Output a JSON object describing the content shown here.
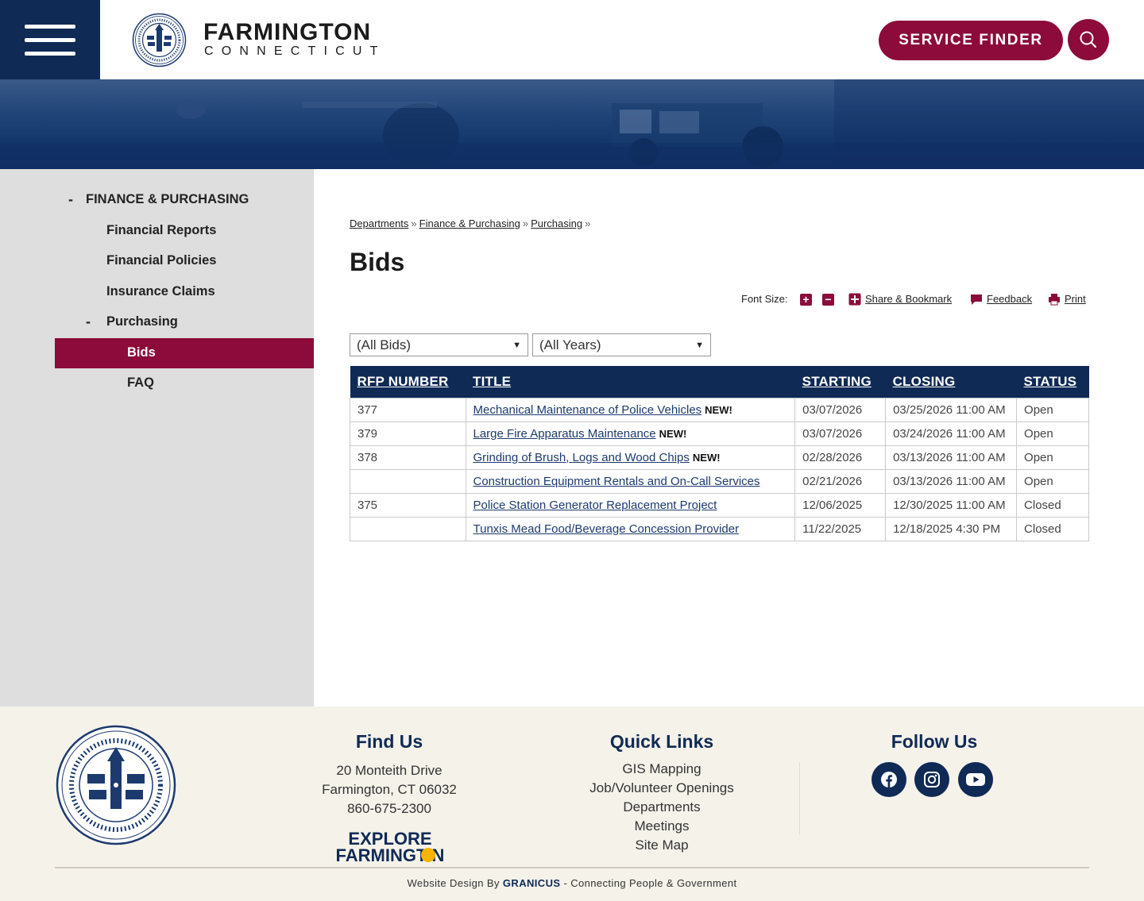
{
  "header": {
    "brand_name": "FARMINGTON",
    "brand_sub": "CONNECTICUT",
    "service_finder": "SERVICE FINDER"
  },
  "sidebar": {
    "section_title": "FINANCE & PURCHASING",
    "items": [
      "Financial Reports",
      "Financial Policies",
      "Insurance Claims",
      "Purchasing"
    ],
    "sub_items": [
      "Bids",
      "FAQ"
    ]
  },
  "breadcrumb": [
    "Departments",
    "Finance & Purchasing",
    "Purchasing"
  ],
  "page_title": "Bids",
  "tools": {
    "font_size_label": "Font Size:",
    "share": "Share & Bookmark",
    "feedback": "Feedback",
    "print": "Print"
  },
  "filters": {
    "bids": "(All Bids)",
    "years": "(All Years)"
  },
  "table": {
    "headers": [
      "RFP NUMBER",
      "TITLE",
      "STARTING",
      "CLOSING",
      "STATUS"
    ],
    "new_tag": "NEW!",
    "rows": [
      {
        "rfp": "377",
        "title": "Mechanical Maintenance of Police Vehicles",
        "new": "NEW!",
        "start": "03/07/2026",
        "close": "03/25/2026 11:00 AM",
        "status": "Open"
      },
      {
        "rfp": "379",
        "title": "Large Fire Apparatus Maintenance",
        "new": "NEW!",
        "start": "03/07/2026",
        "close": "03/24/2026 11:00 AM",
        "status": "Open"
      },
      {
        "rfp": "378",
        "title": "Grinding of Brush, Logs and Wood Chips",
        "new": "NEW!",
        "start": "02/28/2026",
        "close": "03/13/2026 11:00 AM",
        "status": "Open"
      },
      {
        "rfp": "",
        "title": "Construction Equipment Rentals and On-Call Services",
        "new": "",
        "start": "02/21/2026",
        "close": "03/13/2026 11:00 AM",
        "status": "Open"
      },
      {
        "rfp": "375",
        "title": "Police Station Generator Replacement Project",
        "new": "",
        "start": "12/06/2025",
        "close": "12/30/2025 11:00 AM",
        "status": "Closed"
      },
      {
        "rfp": "",
        "title": "Tunxis Mead Food/Beverage Concession Provider",
        "new": "",
        "start": "11/22/2025",
        "close": "12/18/2025 4:30 PM",
        "status": "Closed"
      }
    ]
  },
  "footer": {
    "find_us": {
      "heading": "Find Us",
      "address1": "20 Monteith Drive",
      "address2": "Farmington, CT 06032",
      "phone": "860-675-2300",
      "explore_logo": "EXPLORE FARMINGTON"
    },
    "quick_links": {
      "heading": "Quick Links",
      "links": [
        "GIS Mapping",
        "Job/Volunteer Openings",
        "Departments",
        "Meetings",
        "Site Map"
      ]
    },
    "follow_us": {
      "heading": "Follow Us",
      "icons": [
        "facebook-icon",
        "instagram-icon",
        "youtube-icon"
      ]
    },
    "credit_prefix": "Website Design By ",
    "credit_brand": "GRANICUS",
    "credit_suffix": " - Connecting People & Government"
  },
  "colors": {
    "navy": "#0f2a55",
    "maroon": "#8c0b3b",
    "sidebar_bg": "#dedede",
    "footer_bg": "#f5f2ea"
  }
}
